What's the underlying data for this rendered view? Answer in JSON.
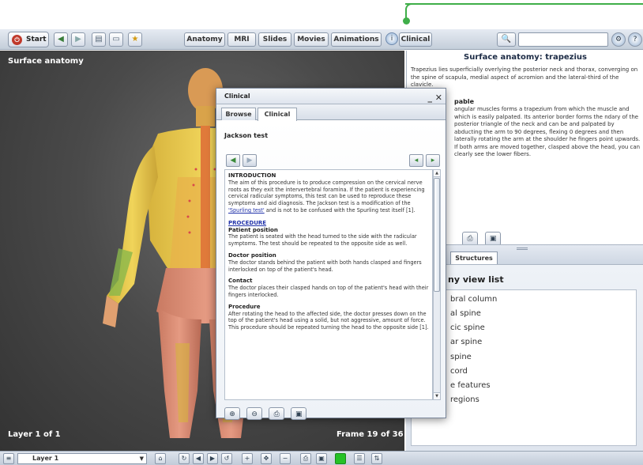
{
  "toolbar": {
    "start_label": "Start",
    "tabs": [
      "Anatomy",
      "MRI",
      "Slides",
      "Movies",
      "Animations"
    ],
    "clinical_label": "Clinical",
    "search_value": ""
  },
  "viewer": {
    "title": "Surface anatomy",
    "layer_info": "Layer 1 of 1",
    "frame_info": "Frame 19 of 36"
  },
  "info_panel": {
    "title": "Surface anatomy: trapezius",
    "intro": "Trapezius lies superficially overlying the posterior neck and thorax, converging on the spine of scapula, medial aspect of acromion and the lateral-third of the clavicle.",
    "subheading": "pable",
    "body": "angular muscles forms a trapezium from which the muscle and which is easily palpated. Its anterior border forms the ndary of the posterior triangle of the neck and can be and palpated by abducting the arm to 90 degrees, flexing 0 degrees and then laterally rotating the arm at the shoulder he fingers point upwards. If both arms are moved together, clasped above the head, you can clearly see the lower fibers."
  },
  "structures": {
    "tab_label": "Structures",
    "heading": "ny view list",
    "items": [
      "bral column",
      "al spine",
      "cic spine",
      "ar spine",
      "spine",
      "cord",
      "e features",
      "regions"
    ]
  },
  "bottom": {
    "layer_label": "Layer 1"
  },
  "dialog": {
    "title": "Clinical",
    "tabs": [
      "Browse",
      "Clinical"
    ],
    "test_title": "Jackson test",
    "intro_heading": "INTRODUCTION",
    "intro_text_a": "The aim of this procedure is to produce compression on the cervical nerve roots as they exit the intervertebral foramina. If the patient is experiencing cervical radicular symptoms, this test can be used to reproduce these symptoms and aid diagnosis. The Jackson test is a modification of the ",
    "intro_link": "'Spurling test'",
    "intro_text_b": " and is not to be confused with the Spurling test itself [1].",
    "procedure_heading": "PROCEDURE",
    "patient_heading": "Patient position",
    "patient_text": "The patient is seated with the head turned to the side with the radicular symptoms. The test should be repeated to the opposite side as well.",
    "doctor_heading": "Doctor position",
    "doctor_text": "The doctor stands behind the patient with both hands clasped and fingers interlocked on top of the patient's head.",
    "contact_heading": "Contact",
    "contact_text": "The doctor places their clasped hands on top of the patient's head with their fingers interlocked.",
    "procedure_sub": "Procedure",
    "procedure_text": "After rotating the head to the affected side, the doctor presses down on the top of the patient's head using a solid, but not aggressive, amount of force. This procedure should be repeated turning the head to the opposite side [1]."
  },
  "colors": {
    "callout": "#3fae49",
    "viewer_bg": "#4a4a4a",
    "link": "#2233aa"
  }
}
